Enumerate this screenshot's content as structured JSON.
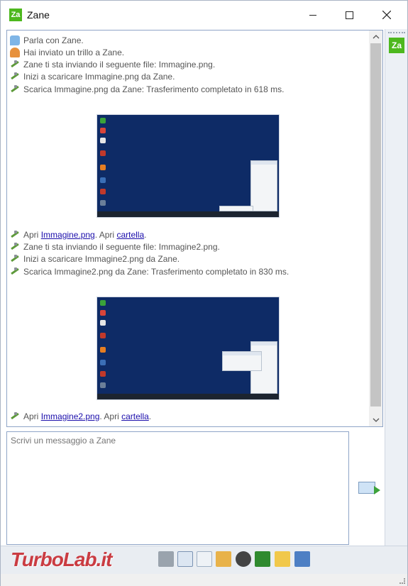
{
  "window": {
    "badge": "Za",
    "title": "Zane"
  },
  "sidebar": {
    "contact_badge": "Za"
  },
  "log": {
    "line1": "Parla con Zane.",
    "line2": "Hai inviato un trillo a Zane.",
    "line3": "Zane ti sta inviando il seguente file: Immagine.png.",
    "line4": "Inizi a scaricare Immagine.png da Zane.",
    "line5": "Scarica Immagine.png da Zane: Trasferimento completato in 618 ms.",
    "open1_prefix": "Apri ",
    "open1_file": "Immagine.png",
    "open1_mid": ". Apri ",
    "open1_folder": "cartella",
    "open1_suffix": ".",
    "line6": "Zane ti sta inviando il seguente file: Immagine2.png.",
    "line7": "Inizi a scaricare Immagine2.png da Zane.",
    "line8": "Scarica Immagine2.png da Zane: Trasferimento completato in 830 ms.",
    "open2_prefix": "Apri ",
    "open2_file": "Immagine2.png",
    "open2_mid": ". Apri ",
    "open2_folder": "cartella",
    "open2_suffix": "."
  },
  "input": {
    "placeholder": "Scrivi un messaggio a Zane"
  },
  "watermark": {
    "text": "TurboLab.it"
  },
  "colors": {
    "brand_green": "#4db81e",
    "desktop_blue": "#0e2b66",
    "link": "#1a0dab"
  }
}
